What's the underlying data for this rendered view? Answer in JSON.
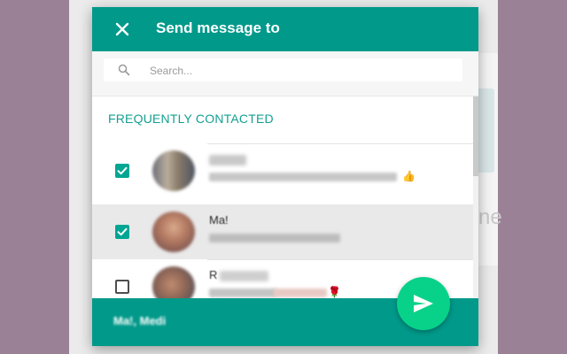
{
  "header": {
    "title": "Send message to",
    "close_icon": "close-icon"
  },
  "search": {
    "placeholder": "Search...",
    "value": ""
  },
  "section": {
    "title": "FREQUENTLY CONTACTED"
  },
  "contacts": [
    {
      "name": "",
      "checked": true,
      "status": "",
      "emoji": "👍"
    },
    {
      "name": "Ma!",
      "checked": true,
      "status": "",
      "emoji": ""
    },
    {
      "name": "R",
      "checked": false,
      "status": "",
      "emoji": "🌹"
    }
  ],
  "footer": {
    "selected_text": "Ma!, Medi"
  },
  "send": {
    "icon": "send-icon"
  },
  "colors": {
    "accent": "#00998a",
    "send_button": "#08d28a",
    "section_title": "#13a092",
    "selected_row": "#e9e9e9"
  }
}
